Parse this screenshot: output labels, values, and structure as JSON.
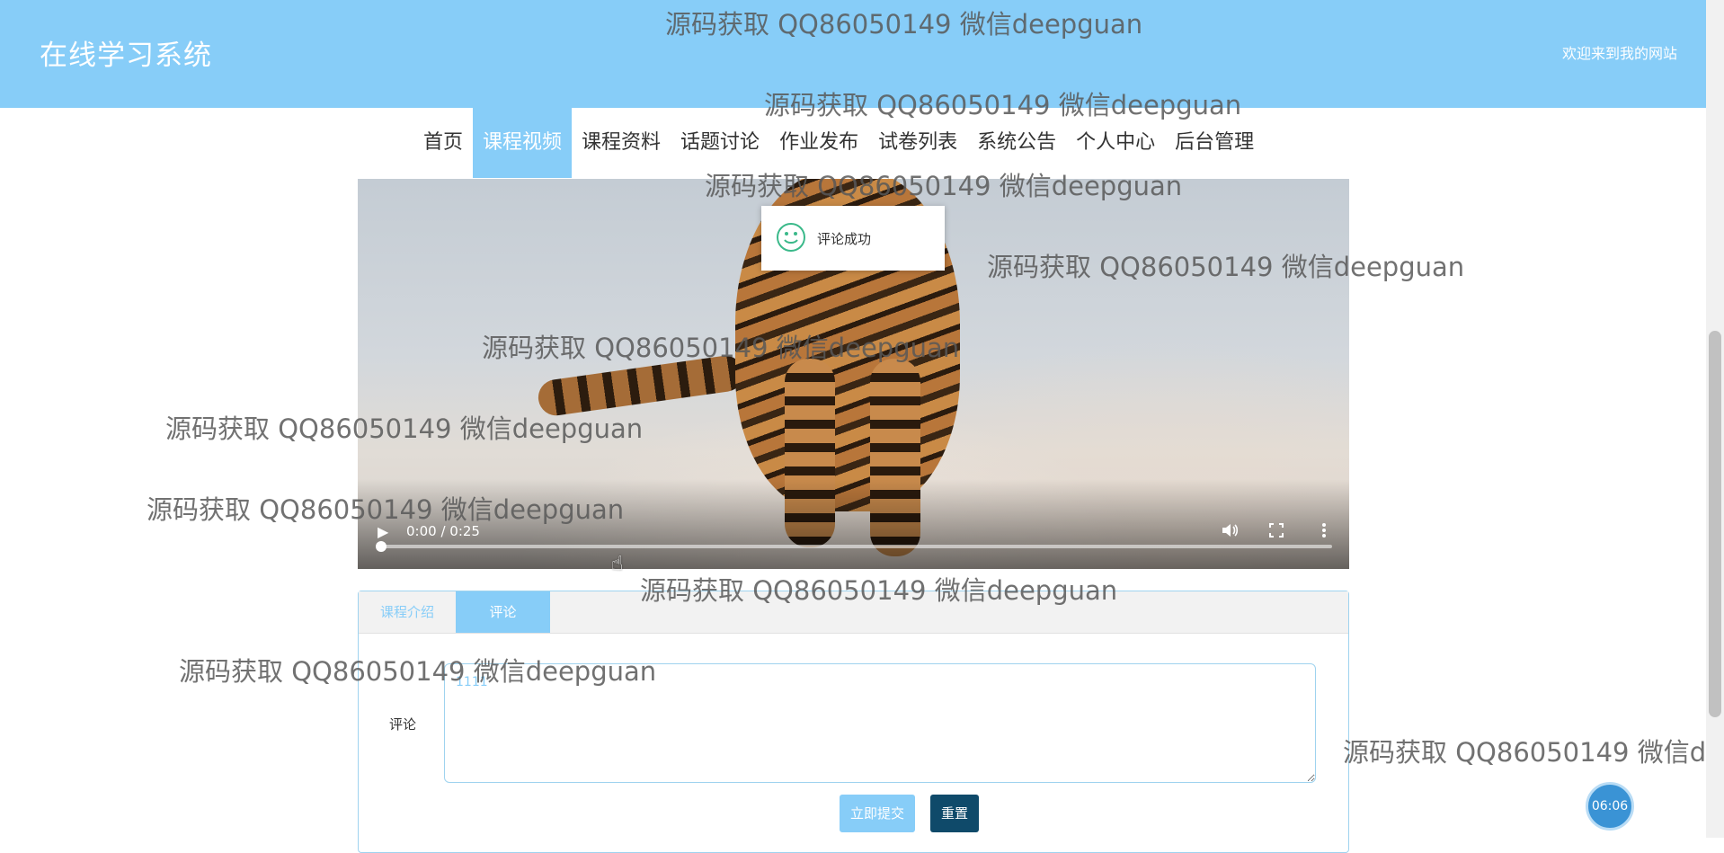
{
  "header": {
    "site_title": "在线学习系统",
    "welcome": "欢迎来到我的网站"
  },
  "nav": {
    "items": [
      "首页",
      "课程视频",
      "课程资料",
      "话题讨论",
      "作业发布",
      "试卷列表",
      "系统公告",
      "个人中心",
      "后台管理"
    ],
    "active": "课程视频"
  },
  "video": {
    "time": "0:00 / 0:25",
    "progress": 0
  },
  "toast": {
    "message": "评论成功"
  },
  "tabs": {
    "intro_label": "课程介绍",
    "comment_label": "评论",
    "active": "评论"
  },
  "comment_form": {
    "label": "评论",
    "value": "1111",
    "submit_label": "立即提交",
    "reset_label": "重置"
  },
  "clock": {
    "time": "06:06"
  },
  "watermark": {
    "text": "源码获取 QQ86050149 微信deepguan"
  },
  "colors": {
    "accent": "#87cdf8",
    "dark_button": "#0f4a6a",
    "clock": "#3a93d5"
  }
}
